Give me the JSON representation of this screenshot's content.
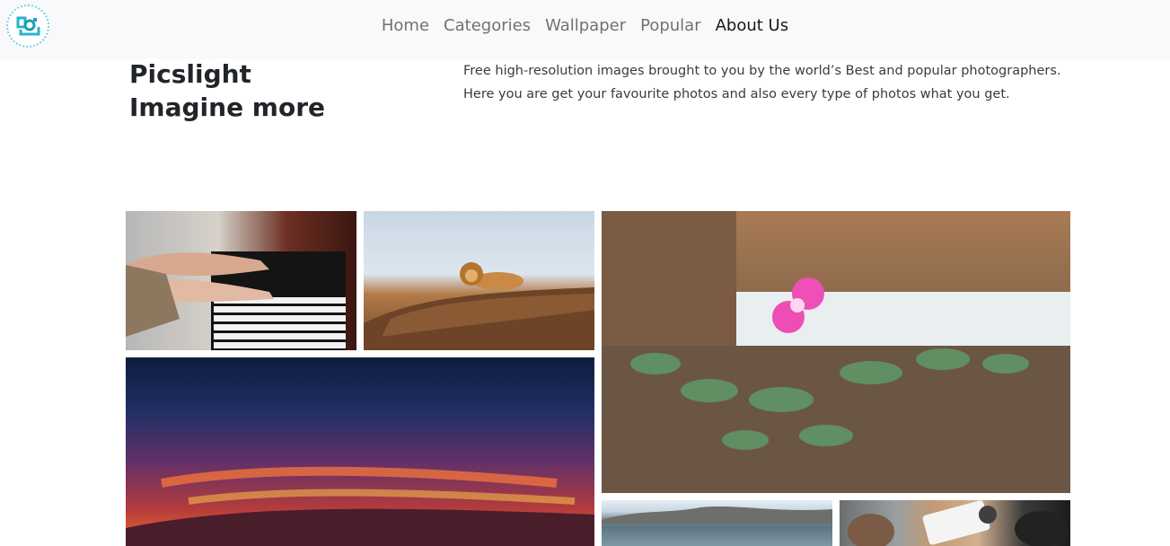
{
  "brand": {
    "logo_icon": "picslight-camera-logo-icon"
  },
  "nav": {
    "items": [
      {
        "label": "Home",
        "active": false
      },
      {
        "label": "Categories",
        "active": false
      },
      {
        "label": "Wallpaper",
        "active": false
      },
      {
        "label": "Popular",
        "active": false
      },
      {
        "label": "About Us",
        "active": true
      }
    ]
  },
  "hero": {
    "title_line1": "Picslight",
    "title_line2": "Imagine more",
    "desc_line1": "Free high-resolution images brought to you by the world’s Best and popular photographers.",
    "desc_line2": "Here you are get your favourite photos and also every type of photos what you get."
  },
  "gallery": {
    "tiles": [
      {
        "subject": "piano"
      },
      {
        "subject": "lion"
      },
      {
        "subject": "flower"
      },
      {
        "subject": "sunset"
      },
      {
        "subject": "lake"
      },
      {
        "subject": "people"
      }
    ]
  },
  "colors": {
    "navbar_bg": "#f8f9fa",
    "logo_teal": "#25b4c9"
  }
}
